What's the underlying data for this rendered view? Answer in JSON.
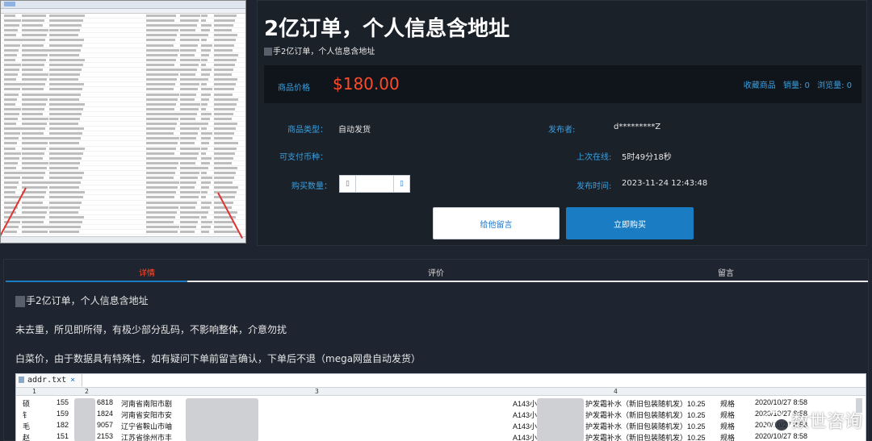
{
  "product": {
    "title": "2亿订单，个人信息含地址",
    "subtitle": "手2亿订单，个人信息含地址",
    "price_label": "商品价格",
    "price": "$180.00",
    "favorite_label": "收藏商品",
    "sales": "销量: 0",
    "views": "浏览量: 0",
    "type_label": "商品类型：",
    "type_value": "自动发货",
    "currency_label": "可支付币种：",
    "quantity_label": "购买数量：",
    "publisher_label": "发布者:",
    "publisher_value": "d*********Z",
    "last_online_label": "上次在线:",
    "last_online_value": "5时49分18秒",
    "publish_time_label": "发布时间:",
    "publish_time_value": "2023-11-24 12:43:48",
    "message_button": "给他留言",
    "buy_button": "立即购买"
  },
  "tabs": [
    {
      "label": "详情",
      "active": true
    },
    {
      "label": "评价",
      "active": false
    },
    {
      "label": "留言",
      "active": false
    }
  ],
  "detail": {
    "line1": "手2亿订单，个人信息含地址",
    "line2": "未去重，所见即所得，有极少部分乱码，不影响整体，介意勿扰",
    "line3": "白菜价，由于数据具有特殊性，如有疑问下单前留言确认，下单后不退（mega网盘自动发货）"
  },
  "textfile": {
    "filename": "addr.txt",
    "close": "×",
    "columns": [
      "1",
      "2",
      "3",
      "4"
    ],
    "rows": [
      {
        "c1": "硕",
        "c2": "155",
        "c2b": "6818",
        "c3": "河南省南阳市剧",
        "c4": "A143小",
        "c4b": "护发霜补水（新旧包装随机发）10.25",
        "c5": "规格",
        "c6": "2020/10/27 8:58"
      },
      {
        "c1": "钅",
        "c2": "159",
        "c2b": "1824",
        "c3": "河南省安阳市安",
        "c4": "A143小",
        "c4b": "护发霜补水（新旧包装随机发）10.25",
        "c5": "规格",
        "c6": "2020/10/27 8:58"
      },
      {
        "c1": "毛",
        "c2": "182",
        "c2b": "9057",
        "c3": "辽宁省鞍山市岫",
        "c4": "A143小",
        "c4b": "护发霜补水（新旧包装随机发）10.25",
        "c5": "规格",
        "c6": "2020/10/27 8:58"
      },
      {
        "c1": "赵",
        "c2": "151",
        "c2b": "2153",
        "c3": "江苏省徐州市丰",
        "c4": "A143小",
        "c4b": "护发霜补水（新旧包装随机发）10.25",
        "c5": "规格",
        "c6": "2020/10/27 8:58"
      }
    ]
  },
  "watermark": "数世咨询",
  "colors": {
    "accent": "#1a7dc4",
    "price": "#ff4a2a",
    "label": "#3aa0e0",
    "background": "#1f2530"
  }
}
